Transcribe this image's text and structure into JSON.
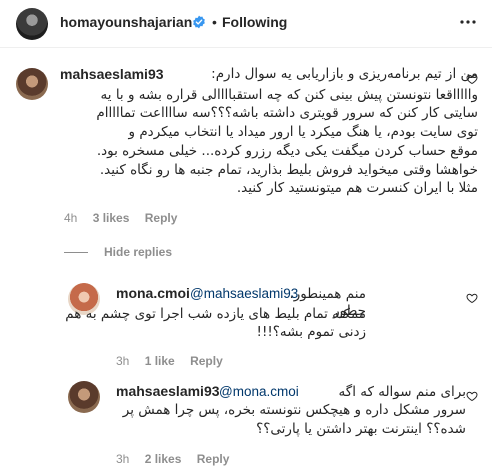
{
  "header": {
    "username": "homayounshajarian",
    "separator": "•",
    "follow_label": "Following",
    "verified": true
  },
  "comments": [
    {
      "username": "mahsaeslami93",
      "lines": [
        "من از تیم برنامه‌ریزی و بازاریابی یه سوال دارم:",
        "واااااقعا نتونستن پیش بینی کنن که چه استقباااالی قراره بشه و با یه",
        "سایتی کار کنن که سرور قویتری داشته باشه؟؟؟سه سااااعت تمااااام",
        "توی سایت بودم، یا هنگ میکرد یا ارور میداد یا انتخاب میکردم و",
        "موقع حساب کردن میگفت یکی دیگه رزرو کرده... خیلی مسخره بود.",
        "خواهشا وقتی میخواید فروش بلیط بذارید، تمام جنبه ها رو نگاه کنید.",
        "مثلا با ایران کنسرت هم میتونستید کار کنید."
      ],
      "time": "4h",
      "likes": "3 likes",
      "reply_label": "Reply"
    }
  ],
  "hide_replies_label": "Hide replies",
  "replies": [
    {
      "username": "mona.cmoi",
      "mention": "@mahsaeslami93",
      "first_text": "منم همینطور. چطور",
      "lines": [
        "ممکنه تمام بلیط های یازده شب اجرا توی چشم به هم",
        "زدنی تموم بشه؟!!!"
      ],
      "time": "3h",
      "likes": "1 like",
      "reply_label": "Reply"
    },
    {
      "username": "mahsaeslami93",
      "mention": "@mona.cmoi",
      "first_text": "برای منم سواله که اگه",
      "lines": [
        "سرور مشکل داره و هیچکس نتونسته بخره، پس چرا همش پر",
        "شده؟؟ اینترنت بهتر داشتن یا پارتی؟؟"
      ],
      "time": "3h",
      "likes": "2 likes",
      "reply_label": "Reply"
    }
  ],
  "colors": {
    "text": "#262626",
    "secondary": "#8e8e8e",
    "link": "#00376b",
    "verified": "#3897f0"
  }
}
